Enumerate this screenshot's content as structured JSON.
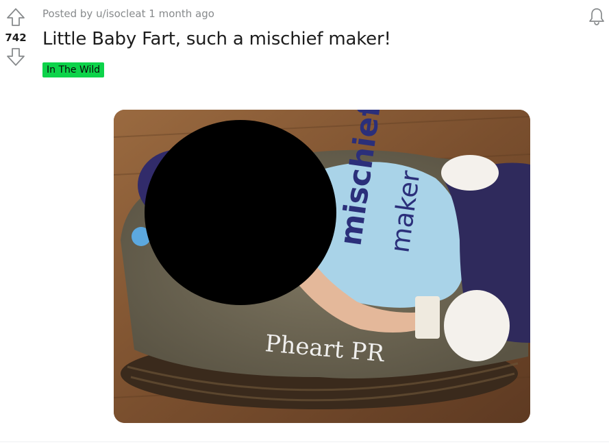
{
  "post": {
    "score": "742",
    "meta": "Posted by u/isocleat 1 month ago",
    "title": "Little Baby Fart, such a mischief maker!",
    "flair": "In The Wild",
    "flair_color": "#0dd34a",
    "image_watermark": "Pheart PR",
    "image_shirt_text": [
      "mischief",
      "maker"
    ],
    "icons": {
      "upvote": "upvote-arrow-icon",
      "downvote": "downvote-arrow-icon",
      "notification": "bell-icon"
    }
  }
}
